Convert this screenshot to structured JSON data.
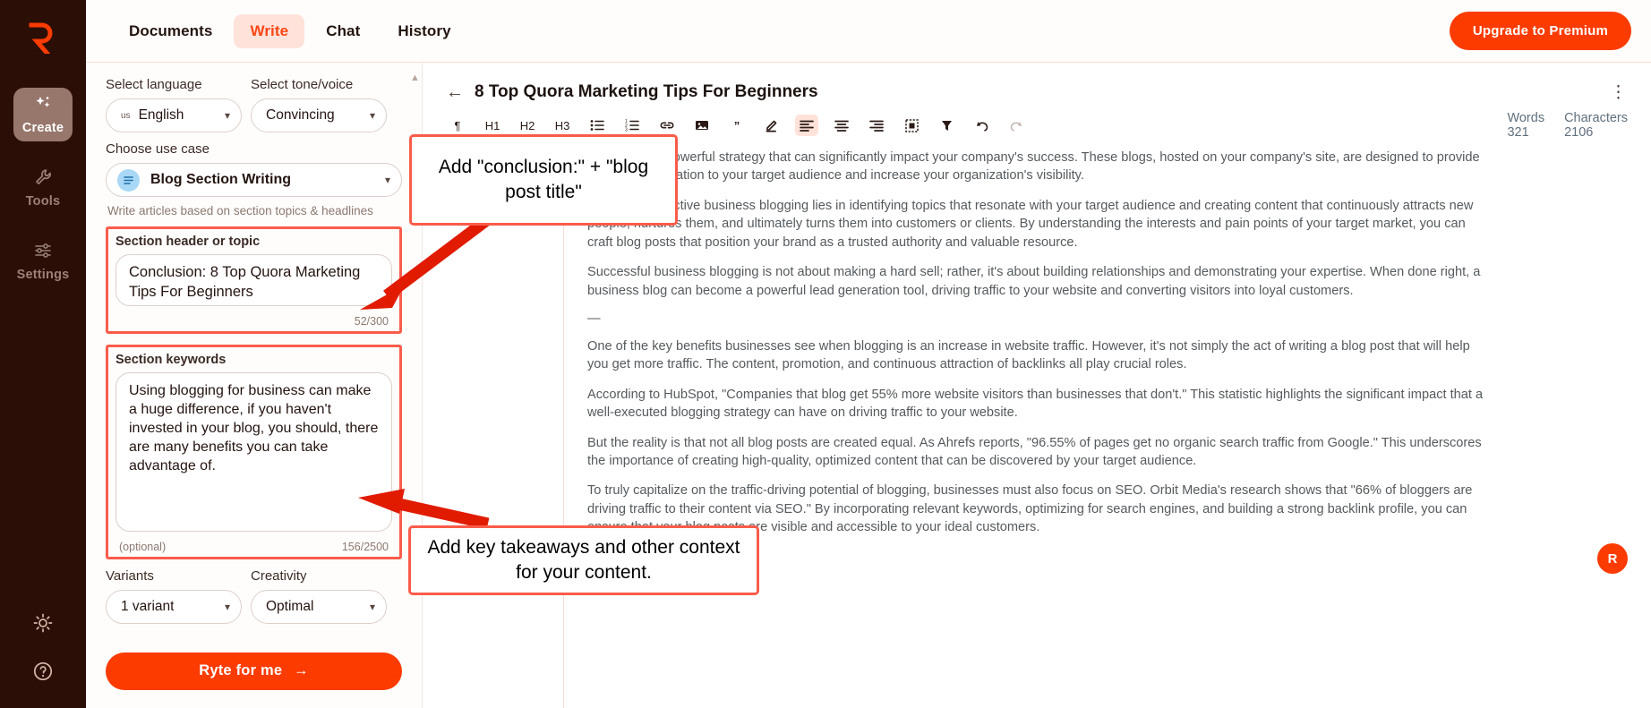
{
  "brand": {
    "logo": "R",
    "accent": "#fb3b00",
    "highlight": "#fa5c4a",
    "rail_bg": "#2b0e06"
  },
  "rail": {
    "items": [
      {
        "label": "Create",
        "icon": "sparkles-icon",
        "active": true
      },
      {
        "label": "Tools",
        "icon": "wrench-icon",
        "active": false
      },
      {
        "label": "Settings",
        "icon": "sliders-icon",
        "active": false
      }
    ],
    "bottom": [
      {
        "icon": "sun-icon",
        "label": "Theme"
      },
      {
        "icon": "help-circle-icon",
        "label": "Help"
      }
    ]
  },
  "topbar": {
    "tabs": [
      {
        "label": "Documents",
        "active": false
      },
      {
        "label": "Write",
        "active": true
      },
      {
        "label": "Chat",
        "active": false
      },
      {
        "label": "History",
        "active": false
      }
    ],
    "upgrade_label": "Upgrade to Premium"
  },
  "panel": {
    "language": {
      "label": "Select language",
      "flag": "us",
      "value": "English"
    },
    "tone": {
      "label": "Select tone/voice",
      "value": "Convincing"
    },
    "use_case": {
      "label": "Choose use case",
      "value": "Blog Section Writing",
      "hint": "Write articles based on section topics & headlines"
    },
    "topic": {
      "label": "Section header or topic",
      "value": "Conclusion: 8 Top Quora Marketing Tips For Beginners",
      "placeholder": "Section header or topic",
      "counter": "52/300"
    },
    "keywords": {
      "label": "Section keywords",
      "value": "Using blogging for business can make a huge difference, if you haven't invested in your blog, you should, there are many benefits you can take advantage of.",
      "placeholder": "Section keywords",
      "optional_label": "(optional)",
      "counter": "156/2500"
    },
    "variants": {
      "label": "Variants",
      "value": "1 variant"
    },
    "creativity": {
      "label": "Creativity",
      "value": "Optimal"
    },
    "submit_label": "Ryte for me",
    "submit_arrow": "→"
  },
  "editor": {
    "back_icon": "arrow-left-icon",
    "title": "8 Top Quora Marketing Tips For Beginners",
    "kebab_icon": "more-vertical-icon",
    "stats": [
      {
        "key": "Words",
        "value": "321"
      },
      {
        "key": "Characters",
        "value": "2106"
      }
    ],
    "toolbar": [
      {
        "icon": "paragraph-style-icon",
        "label": "Paragraph"
      },
      {
        "icon": "heading-h1-icon",
        "label": "H1"
      },
      {
        "icon": "heading-h2-icon",
        "label": "H2"
      },
      {
        "icon": "heading-h3-icon",
        "label": "H3"
      },
      {
        "icon": "bullet-list-icon",
        "label": "Bullet list"
      },
      {
        "icon": "numbered-list-icon",
        "label": "Numbered list"
      },
      {
        "icon": "link-icon",
        "label": "Insert link"
      },
      {
        "icon": "image-icon",
        "label": "Insert image"
      },
      {
        "icon": "quote-icon",
        "label": "Blockquote"
      },
      {
        "icon": "highlight-pen-icon",
        "label": "Highlight"
      },
      {
        "icon": "align-left-icon",
        "label": "Align left",
        "active": true
      },
      {
        "icon": "align-center-icon",
        "label": "Align center"
      },
      {
        "icon": "align-right-icon",
        "label": "Align right"
      },
      {
        "icon": "table-icon",
        "label": "Insert table"
      },
      {
        "icon": "clear-format-icon",
        "label": "Clear formatting"
      },
      {
        "icon": "undo-icon",
        "label": "Undo"
      },
      {
        "icon": "redo-icon",
        "label": "Redo"
      }
    ],
    "paragraphs": [
      "Blogging is a powerful strategy that can significantly impact your company's success. These blogs, hosted on your company's site, are designed to provide valuable information to your target audience and increase your organization's visibility.",
      "The key to effective business blogging lies in identifying topics that resonate with your target audience and creating content that continuously attracts new people, nurtures them, and ultimately turns them into customers or clients. By understanding the interests and pain points of your target market, you can craft blog posts that position your brand as a trusted authority and valuable resource.",
      "Successful business blogging is not about making a hard sell; rather, it's about building relationships and demonstrating your expertise. When done right, a business blog can become a powerful lead generation tool, driving traffic to your website and converting visitors into loyal customers.",
      "—",
      "One of the key benefits businesses see when blogging is an increase in website traffic. However, it's not simply the act of writing a blog post that will help you get more traffic. The content, promotion, and continuous attraction of backlinks all play crucial roles.",
      "According to HubSpot, \"Companies that blog get 55% more website visitors than businesses that don't.\" This statistic highlights the significant impact that a well-executed blogging strategy can have on driving traffic to your website.",
      "But the reality is that not all blog posts are created equal. As Ahrefs reports, \"96.55% of pages get no organic search traffic from Google.\" This underscores the importance of creating high-quality, optimized content that can be discovered by your target audience.",
      "To truly capitalize on the traffic-driving potential of blogging, businesses must also focus on SEO. Orbit Media's research shows that \"66% of bloggers are driving traffic to their content via SEO.\" By incorporating relevant keywords, optimizing for search engines, and building a strong backlink profile, you can ensure that your blog posts are visible and accessible to your ideal customers."
    ],
    "fab_label": "R"
  },
  "annotations": [
    {
      "id": "annotation-topic",
      "text": "Add \"conclusion:\" + \"blog post title\""
    },
    {
      "id": "annotation-keywords",
      "text": "Add key takeaways and other context for your content."
    }
  ]
}
